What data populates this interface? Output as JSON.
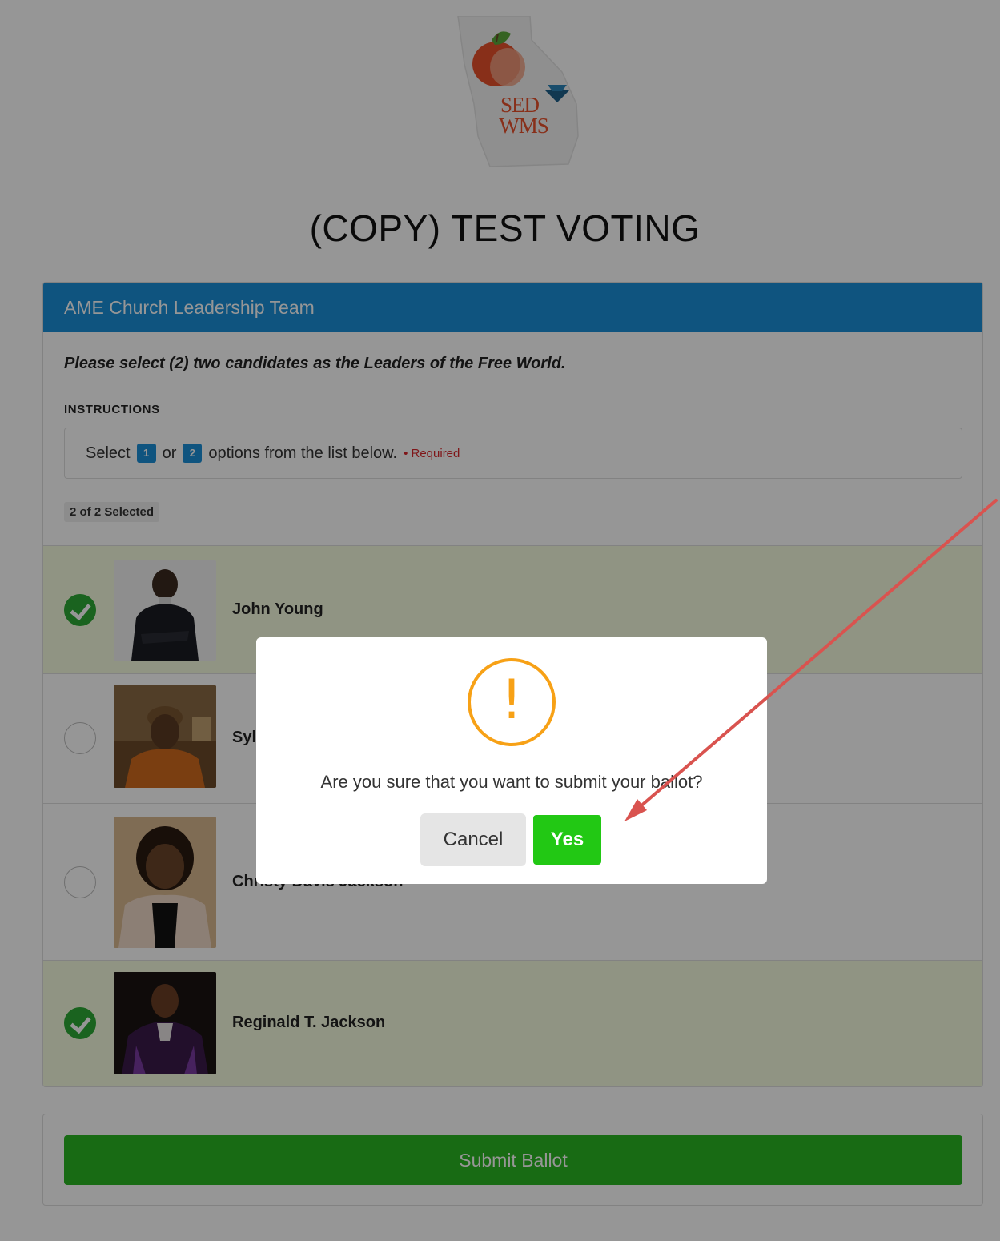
{
  "logo": {
    "text_line1": "SED",
    "text_line2": "WMS"
  },
  "page_title": "(COPY) TEST VOTING",
  "ballot": {
    "header": "AME Church Leadership Team",
    "question": "Please select (2) two candidates as the Leaders of the Free World.",
    "instructions_label": "INSTRUCTIONS",
    "instructions": {
      "prefix": "Select",
      "min": "1",
      "conj": "or",
      "max": "2",
      "suffix": "options from the list below.",
      "required": "• Required"
    },
    "selected_count": "2 of 2 Selected",
    "candidates": [
      {
        "name": "John Young",
        "selected": true
      },
      {
        "name": "Syl",
        "selected": false
      },
      {
        "name": "Christy Davis Jackson",
        "selected": false
      },
      {
        "name": "Reginald T. Jackson",
        "selected": true
      }
    ]
  },
  "submit_button": "Submit Ballot",
  "modal": {
    "icon": "warning-icon",
    "symbol": "!",
    "message": "Are you sure that you want to submit your ballot?",
    "cancel_label": "Cancel",
    "yes_label": "Yes"
  },
  "colors": {
    "header_blue": "#1a8fd9",
    "selected_row": "#f5fbdf",
    "check_green": "#2da935",
    "submit_green": "#2ab622",
    "yes_green": "#22c814",
    "warning_orange": "#f7a116",
    "annotation_arrow": "#d9534f"
  }
}
